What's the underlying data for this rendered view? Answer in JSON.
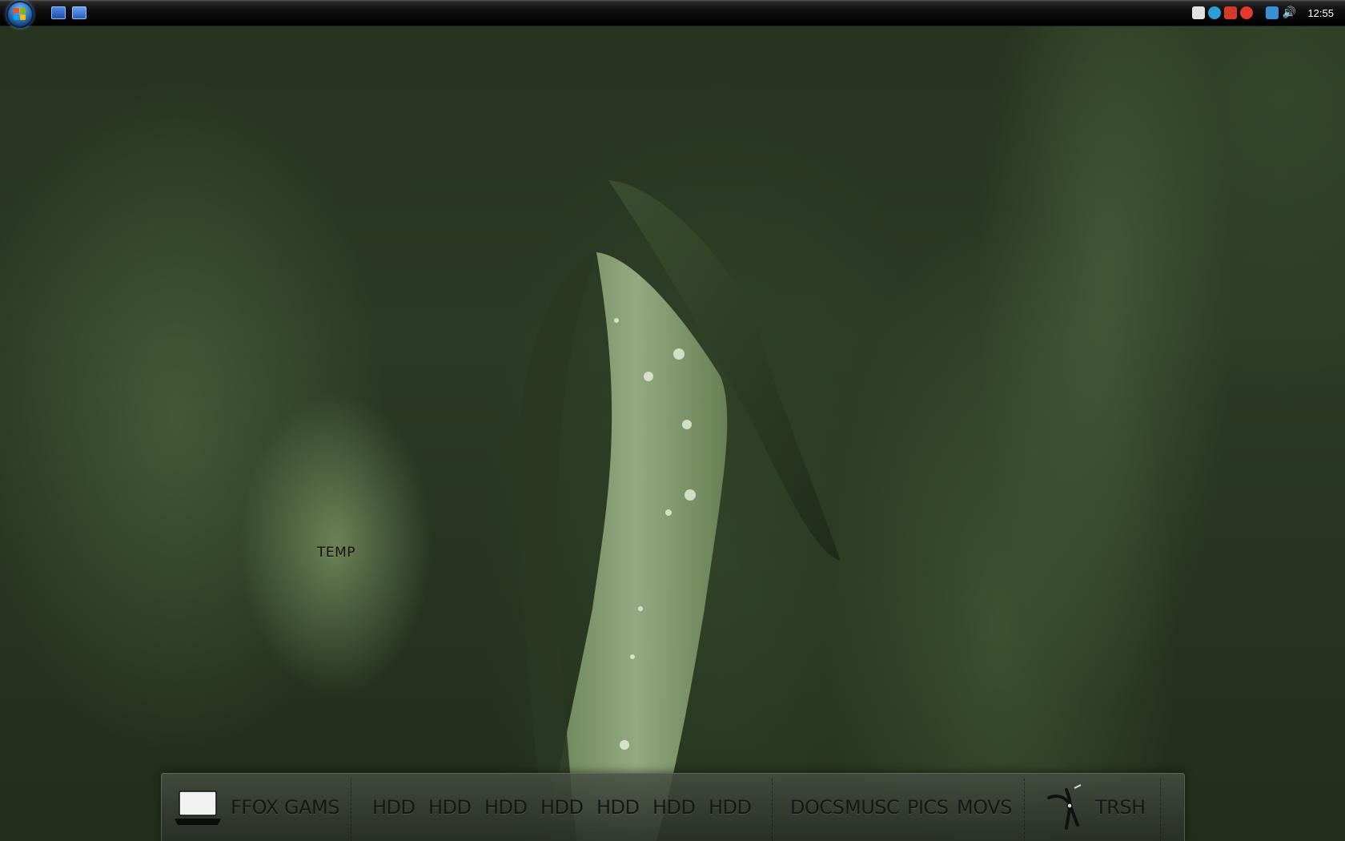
{
  "taskbar": {
    "clock": "12:55",
    "quick_launch": [
      "show-desktop-icon",
      "switch-windows-icon"
    ],
    "tray_icons": [
      {
        "name": "network-card-icon",
        "color": "#e0e0e0"
      },
      {
        "name": "globe-icon",
        "color": "#2a9fd6"
      },
      {
        "name": "security-icon",
        "color": "#d33a2c"
      },
      {
        "name": "antivirus-icon",
        "color": "#e23a2c"
      },
      {
        "name": "network-icon",
        "color": "#3b8ed6"
      },
      {
        "name": "volume-icon",
        "color": "#d8d8d8"
      }
    ]
  },
  "desktop": {
    "label": "TEMP"
  },
  "dock": {
    "items": [
      {
        "label": "FFOX"
      },
      {
        "label": "GAMS"
      },
      {
        "label": "HDD"
      },
      {
        "label": "HDD"
      },
      {
        "label": "HDD"
      },
      {
        "label": "HDD"
      },
      {
        "label": "HDD"
      },
      {
        "label": "HDD"
      },
      {
        "label": "HDD"
      },
      {
        "label": "DOCS"
      },
      {
        "label": "MUSC"
      },
      {
        "label": "PICS"
      },
      {
        "label": "MOVS"
      },
      {
        "label": "TRSH"
      }
    ]
  }
}
